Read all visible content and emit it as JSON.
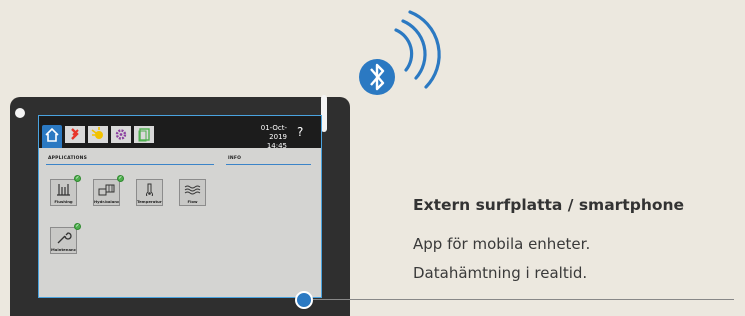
{
  "bluetooth": {
    "icon": "bluetooth-icon",
    "color": "#2b79c2"
  },
  "device": {
    "topbar": {
      "tabs": [
        {
          "icon": "home-icon",
          "color": "#2b79c2"
        },
        {
          "icon": "swap-arrows-icon",
          "color": "#e8352a"
        },
        {
          "icon": "sun-icon",
          "color": "#f2c200"
        },
        {
          "icon": "gear-icon",
          "color": "#8b3fa0"
        },
        {
          "icon": "document-icon",
          "color": "#4fb04f"
        }
      ],
      "date": "01-Oct-2019",
      "time": "14:45",
      "help": "?"
    },
    "sections": {
      "applications": "APPLICATIONS",
      "info": "INFO"
    },
    "apps": [
      {
        "label": "Flushing",
        "icon": "flushing-icon",
        "badge": true
      },
      {
        "label": "Hydr.balanc.",
        "icon": "hydraulic-balance-icon",
        "badge": true
      },
      {
        "label": "Temperature",
        "icon": "thermometer-icon",
        "badge": false
      },
      {
        "label": "Flow",
        "icon": "flow-waves-icon",
        "badge": false
      },
      {
        "label": "Maintenance",
        "icon": "wrench-icon",
        "badge": true
      }
    ]
  },
  "caption": {
    "title": "Extern surfplatta / smartphone",
    "line1": "App för mobila enheter.",
    "line2": "Datahämtning i realtid."
  }
}
